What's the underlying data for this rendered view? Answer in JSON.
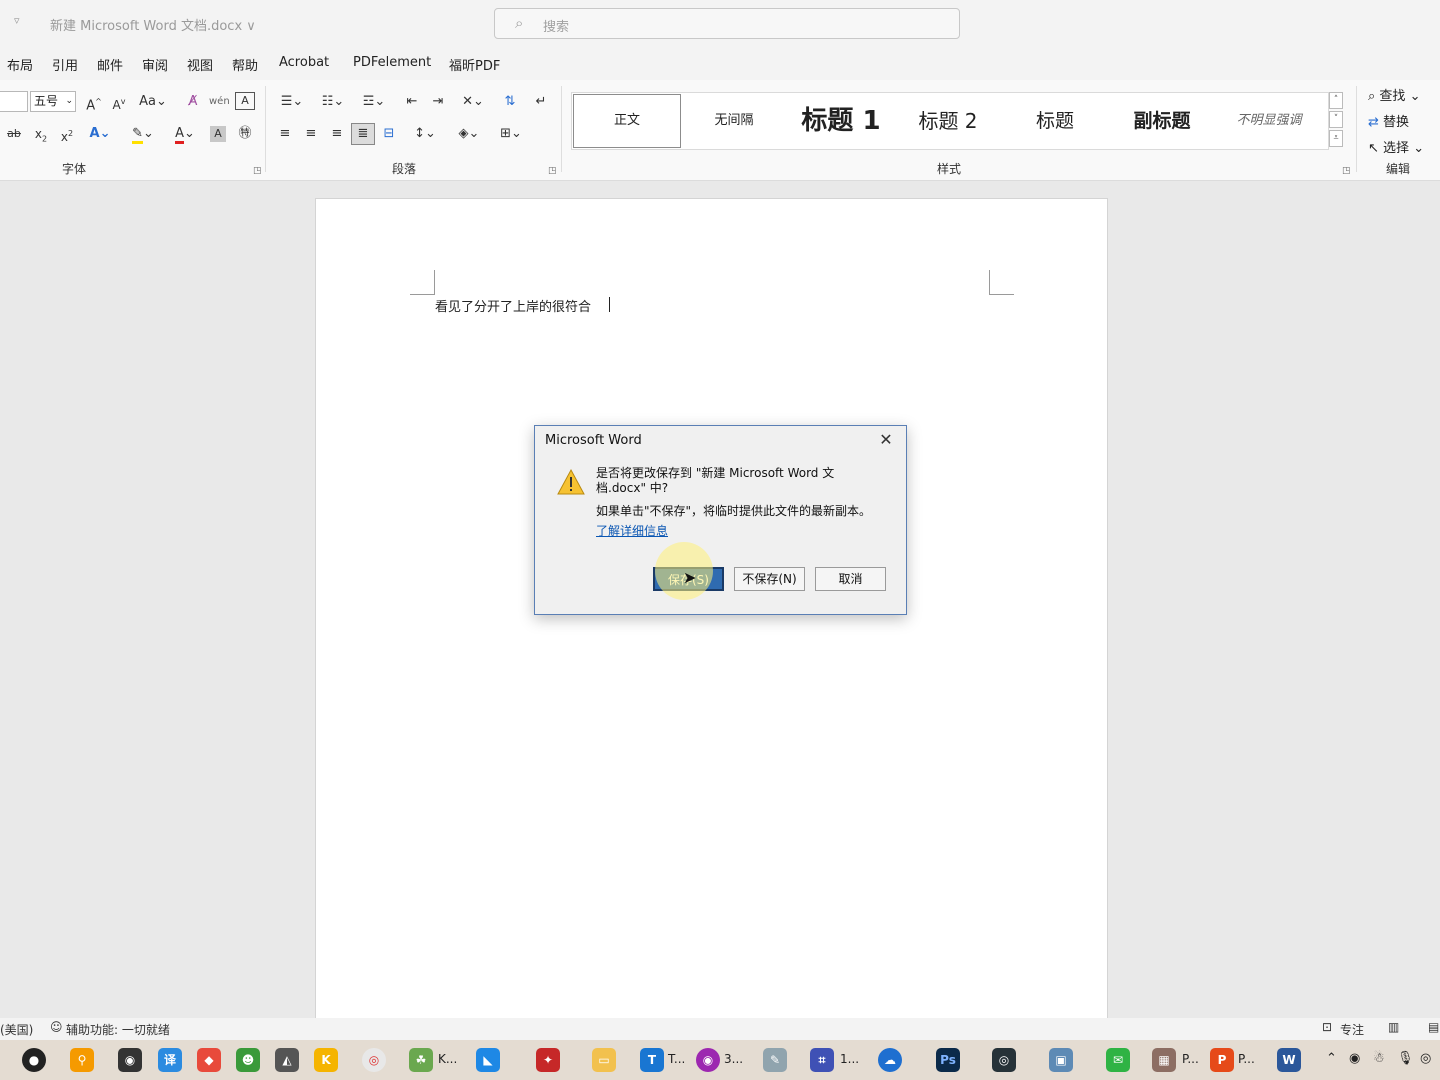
{
  "titlebar": {
    "doc_title": "新建 Microsoft Word 文档.docx ∨",
    "search_placeholder": "搜索"
  },
  "tabs": [
    "布局",
    "引用",
    "邮件",
    "审阅",
    "视图",
    "帮助",
    "Acrobat",
    "PDFelement",
    "福昕PDF"
  ],
  "ribbon": {
    "font_size": "五号",
    "group_font": "字体",
    "group_paragraph": "段落",
    "group_styles": "样式",
    "group_editing": "编辑",
    "styles": [
      "正文",
      "无间隔",
      "标题 1",
      "标题 2",
      "标题",
      "副标题",
      "不明显强调"
    ],
    "edit_find": "查找",
    "edit_replace": "替换",
    "edit_select": "选择"
  },
  "document": {
    "text": "看见了分开了上岸的很符合"
  },
  "dialog": {
    "title": "Microsoft Word",
    "message_line1": "是否将更改保存到 \"新建 Microsoft Word 文档.docx\" 中?",
    "message_line2": "如果单击\"不保存\"，将临时提供此文件的最新副本。",
    "link": "了解详细信息",
    "save_button": "保存(S)",
    "dont_save_button": "不保存(N)",
    "cancel_button": "取消"
  },
  "statusbar": {
    "language": "(美国)",
    "accessibility": "辅助功能: 一切就绪",
    "focus": "专注"
  },
  "taskbar": {
    "labels": [
      "K...",
      "T...",
      "3...",
      "1...",
      "P...",
      "P..."
    ]
  },
  "colors": {
    "accent_blue": "#2f6bb0",
    "link_blue": "#0a56b3",
    "warning_yellow": "#f6c232",
    "font_color_red": "#e02020",
    "highlight_yellow": "#ffe000"
  }
}
